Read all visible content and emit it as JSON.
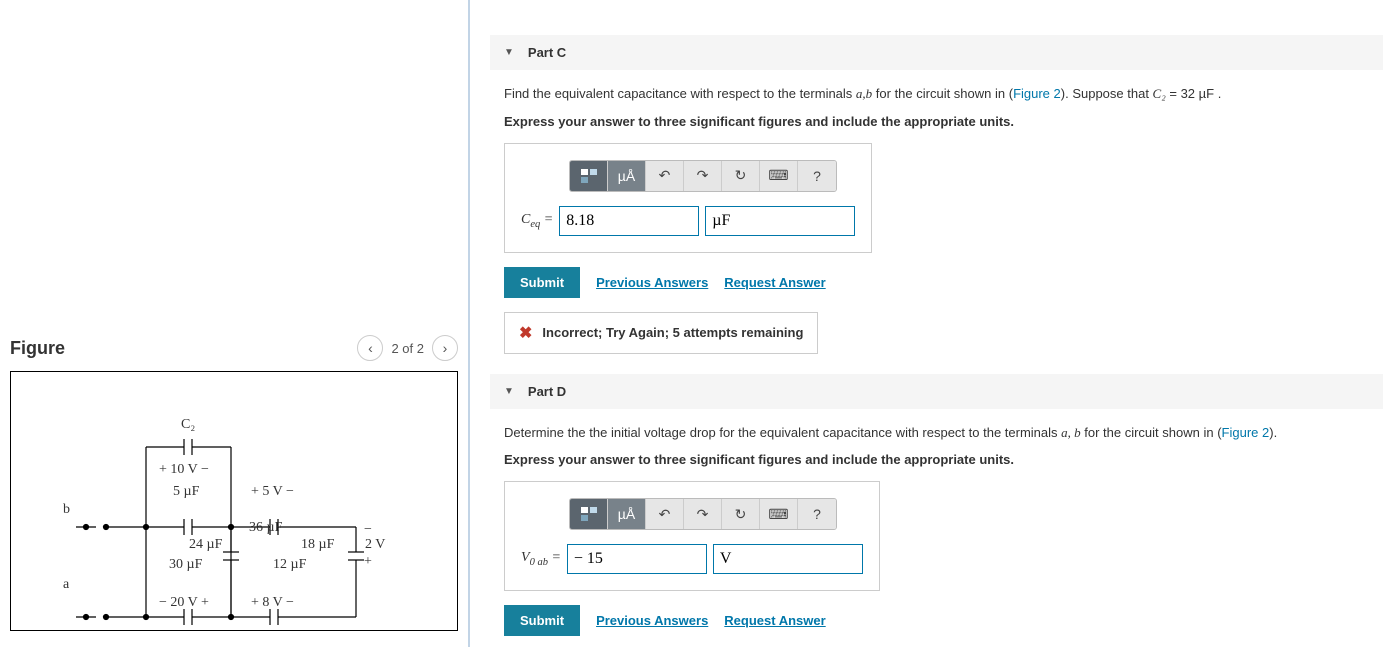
{
  "figure": {
    "title": "Figure",
    "nav_text": "2 of 2",
    "labels": {
      "c2": "C₂",
      "v10": "+  10 V  −",
      "c5uf": "5 µF",
      "v5": "+   5 V   −",
      "c36uf": "36 µF",
      "c24uf": "24 µF",
      "c18uf": "18 µF",
      "v2": "2 V",
      "c30uf": "30 µF",
      "c12uf": "12 µF",
      "v20": "−  20 V  +",
      "v8": "+   8 V   −",
      "b": "b",
      "a": "a",
      "minus": "−",
      "plus": "+"
    }
  },
  "partC": {
    "title": "Part C",
    "prompt_pre": "Find the equivalent capacitance with respect to the terminals ",
    "prompt_ab": "a,b",
    "prompt_mid": " for the circuit shown in (",
    "figure_link": "Figure 2",
    "prompt_post": "). Suppose that ",
    "c2_var": "C₂",
    "c2_val": " = 32  µF",
    "period": " .",
    "instruction": "Express your answer to three significant figures and include the appropriate units.",
    "toolbar": {
      "units_btn": "µÅ",
      "help": "?"
    },
    "answer_label": "Cₑq =",
    "value": "8.18",
    "units": "µF",
    "submit": "Submit",
    "prev_answers": "Previous Answers",
    "request": "Request Answer",
    "feedback": "Incorrect; Try Again; 5 attempts remaining"
  },
  "partD": {
    "title": "Part D",
    "prompt_pre": "Determine the the initial voltage drop for the equivalent capacitance with respect to the terminals ",
    "prompt_ab": "a, b",
    "prompt_mid": " for the circuit shown in (",
    "figure_link": "Figure 2",
    "prompt_post": ").",
    "instruction": "Express your answer to three significant figures and include the appropriate units.",
    "toolbar": {
      "units_btn": "µÅ",
      "help": "?"
    },
    "answer_label": "V₀ₐb =",
    "value": "− 15",
    "units": "V",
    "submit": "Submit",
    "prev_answers": "Previous Answers",
    "request": "Request Answer"
  }
}
